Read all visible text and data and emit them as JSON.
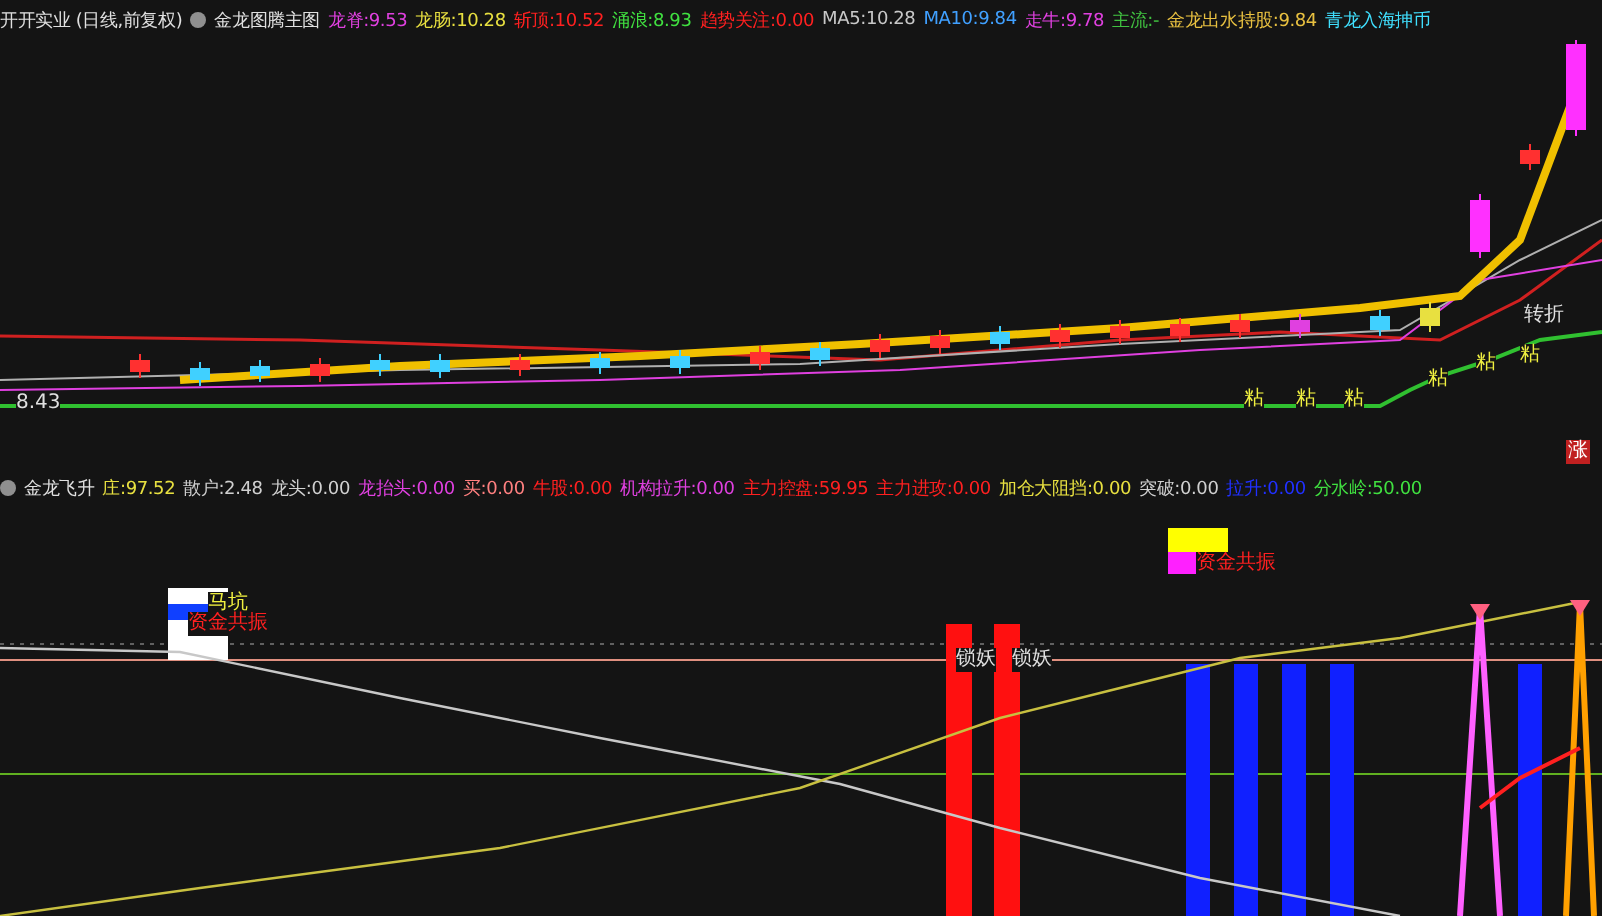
{
  "main_panel": {
    "title": "开开实业 (日线,前复权)",
    "indicator_name": "金龙图腾主图",
    "legend": [
      {
        "label": "龙脊:",
        "value": "9.53",
        "color": "#e040e0"
      },
      {
        "label": "龙肠:",
        "value": "10.28",
        "color": "#e8e040"
      },
      {
        "label": "斩顶:",
        "value": "10.52",
        "color": "#ff2020"
      },
      {
        "label": "涌浪:",
        "value": "8.93",
        "color": "#40e040"
      },
      {
        "label": "趋势关注:",
        "value": "0.00",
        "color": "#ff2020"
      },
      {
        "label": "MA5:",
        "value": "10.28",
        "color": "#c8c8c8"
      },
      {
        "label": "MA10:",
        "value": "9.84",
        "color": "#40a0ff"
      },
      {
        "label": "走牛:",
        "value": "9.78",
        "color": "#e040e0"
      },
      {
        "label": "主流:",
        "value": "-",
        "color": "#40c040"
      },
      {
        "label": "金龙出水持股:",
        "value": "9.84",
        "color": "#e8c040"
      },
      {
        "label": "青龙入海抻币",
        "color": "#40e0ff"
      }
    ],
    "price_label": "8.43",
    "stick_labels": [
      "粘",
      "粘",
      "粘",
      "粘",
      "粘",
      "粘"
    ],
    "turn_label": "转折",
    "rise_label": "涨"
  },
  "sub_panel": {
    "indicator_name": "金龙飞升",
    "legend": [
      {
        "label": "庄:",
        "value": "97.52",
        "color": "#e8e040"
      },
      {
        "label": "散户:",
        "value": "2.48",
        "color": "#d0d0d0"
      },
      {
        "label": "龙头:",
        "value": "0.00",
        "color": "#d0d0d0"
      },
      {
        "label": "龙抬头:",
        "value": "0.00",
        "color": "#e040e0"
      },
      {
        "label": "买:",
        "value": "0.00",
        "color": "#ff8080"
      },
      {
        "label": "牛股:",
        "value": "0.00",
        "color": "#ff2020"
      },
      {
        "label": "机构拉升:",
        "value": "0.00",
        "color": "#e040e0"
      },
      {
        "label": "主力控盘:",
        "value": "59.95",
        "color": "#ff2020"
      },
      {
        "label": "主力进攻:",
        "value": "0.00",
        "color": "#ff2020"
      },
      {
        "label": "加仓大阻挡:",
        "value": "0.00",
        "color": "#e8e040"
      },
      {
        "label": "突破:",
        "value": "0.00",
        "color": "#d0d0d0"
      },
      {
        "label": "拉升:",
        "value": "0.00",
        "color": "#2030ff"
      },
      {
        "label": "分水岭:",
        "value": "50.00",
        "color": "#40e040"
      }
    ],
    "pit_label": "马坑",
    "resonance_labels": [
      "资金共振",
      "资金共振"
    ],
    "lock_labels": [
      "锁妖",
      "锁妖"
    ]
  }
}
